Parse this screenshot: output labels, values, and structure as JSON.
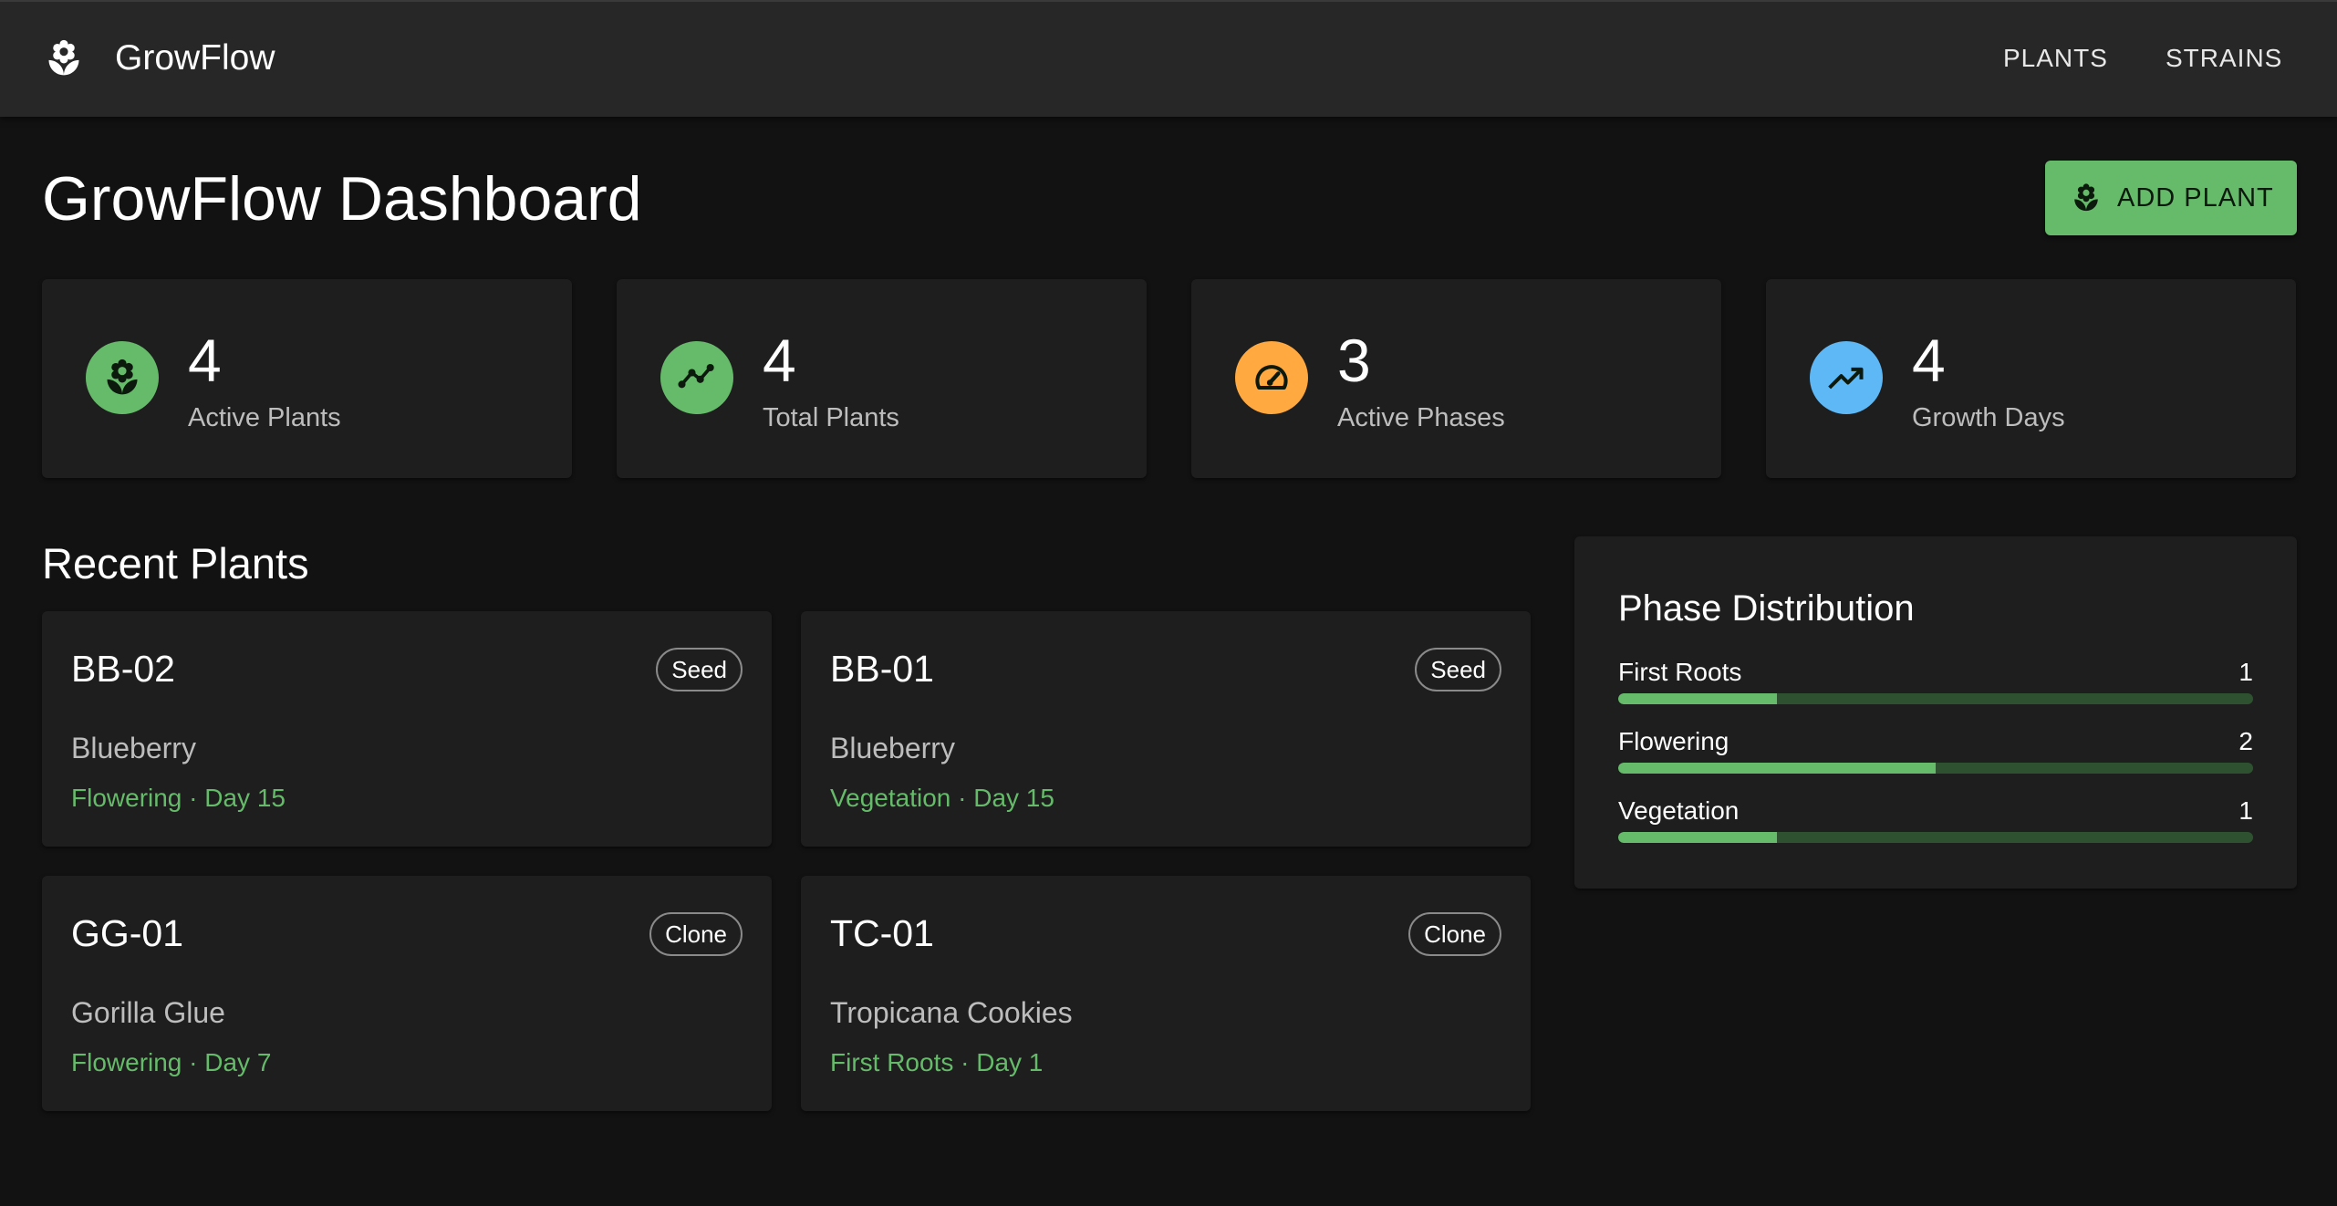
{
  "appbar": {
    "title": "GrowFlow",
    "nav": [
      {
        "label": "PLANTS"
      },
      {
        "label": "STRAINS"
      }
    ]
  },
  "page": {
    "title": "GrowFlow Dashboard",
    "add_button_label": "ADD PLANT"
  },
  "stats": [
    {
      "value": "4",
      "label": "Active Plants",
      "icon": "flower-icon",
      "color": "#66bb6a"
    },
    {
      "value": "4",
      "label": "Total Plants",
      "icon": "timeline-icon",
      "color": "#66bb6a"
    },
    {
      "value": "3",
      "label": "Active Phases",
      "icon": "speed-icon",
      "color": "#ffa940"
    },
    {
      "value": "4",
      "label": "Growth Days",
      "icon": "trending-up-icon",
      "color": "#5eb8f5"
    }
  ],
  "recent": {
    "title": "Recent Plants",
    "plants": [
      {
        "id": "BB-02",
        "type": "Seed",
        "strain": "Blueberry",
        "phase": "Flowering · Day 15"
      },
      {
        "id": "BB-01",
        "type": "Seed",
        "strain": "Blueberry",
        "phase": "Vegetation · Day 15"
      },
      {
        "id": "GG-01",
        "type": "Clone",
        "strain": "Gorilla Glue",
        "phase": "Flowering · Day 7"
      },
      {
        "id": "TC-01",
        "type": "Clone",
        "strain": "Tropicana Cookies",
        "phase": "First Roots · Day 1"
      }
    ]
  },
  "distribution": {
    "title": "Phase Distribution",
    "rows": [
      {
        "label": "First Roots",
        "count": "1",
        "fraction": 0.25
      },
      {
        "label": "Flowering",
        "count": "2",
        "fraction": 0.5
      },
      {
        "label": "Vegetation",
        "count": "1",
        "fraction": 0.25
      }
    ]
  },
  "colors": {
    "accent": "#66bb6a",
    "background": "#121212",
    "card": "#1e1e1e",
    "appbar": "#272727"
  }
}
